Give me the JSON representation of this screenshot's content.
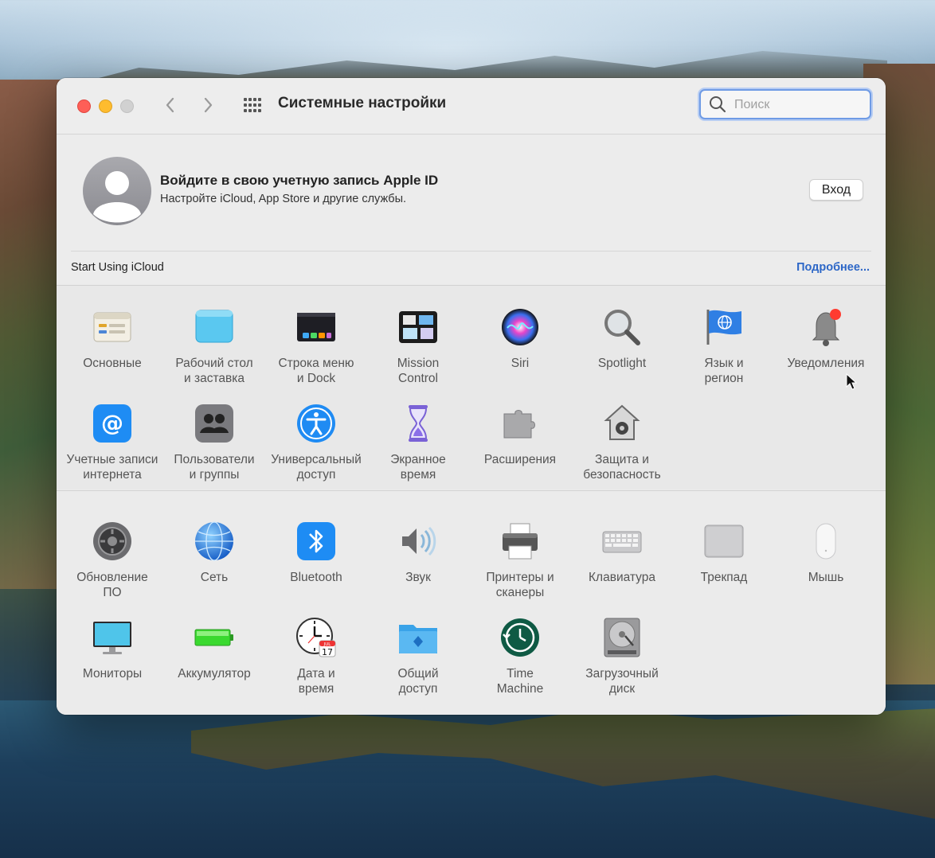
{
  "window": {
    "title": "Системные настройки",
    "search_placeholder": "Поиск"
  },
  "account": {
    "title": "Войдите в свою учетную запись Apple ID",
    "subtitle": "Настройте iCloud, App Store и другие службы.",
    "login_label": "Вход"
  },
  "icloud": {
    "label": "Start Using iCloud",
    "more_label": "Подробнее..."
  },
  "panes_row1": [
    {
      "icon": "general-icon",
      "line1": "Основные",
      "line2": ""
    },
    {
      "icon": "desktop-icon",
      "line1": "Рабочий стол",
      "line2": "и заставка"
    },
    {
      "icon": "menu-bar-dock-icon",
      "line1": "Строка меню",
      "line2": "и Dock"
    },
    {
      "icon": "mission-control-icon",
      "line1": "Mission",
      "line2": "Control"
    },
    {
      "icon": "siri-icon",
      "line1": "Siri",
      "line2": ""
    },
    {
      "icon": "spotlight-icon",
      "line1": "Spotlight",
      "line2": ""
    },
    {
      "icon": "language-region-icon",
      "line1": "Язык и",
      "line2": "регион"
    },
    {
      "icon": "notifications-icon",
      "line1": "Уведомления",
      "line2": ""
    }
  ],
  "panes_row2": [
    {
      "icon": "internet-accounts-icon",
      "line1": "Учетные записи",
      "line2": "интернета"
    },
    {
      "icon": "users-groups-icon",
      "line1": "Пользователи",
      "line2": "и группы"
    },
    {
      "icon": "accessibility-icon",
      "line1": "Универсальный",
      "line2": "доступ"
    },
    {
      "icon": "screen-time-icon",
      "line1": "Экранное",
      "line2": "время"
    },
    {
      "icon": "extensions-icon",
      "line1": "Расширения",
      "line2": ""
    },
    {
      "icon": "security-privacy-icon",
      "line1": "Защита и",
      "line2": "безопасность"
    }
  ],
  "panes_row3": [
    {
      "icon": "software-update-icon",
      "line1": "Обновление",
      "line2": "ПО"
    },
    {
      "icon": "network-icon",
      "line1": "Сеть",
      "line2": ""
    },
    {
      "icon": "bluetooth-icon",
      "line1": "Bluetooth",
      "line2": ""
    },
    {
      "icon": "sound-icon",
      "line1": "Звук",
      "line2": ""
    },
    {
      "icon": "printers-scanners-icon",
      "line1": "Принтеры и",
      "line2": "сканеры"
    },
    {
      "icon": "keyboard-icon",
      "line1": "Клавиатура",
      "line2": ""
    },
    {
      "icon": "trackpad-icon",
      "line1": "Трекпад",
      "line2": ""
    },
    {
      "icon": "mouse-icon",
      "line1": "Мышь",
      "line2": ""
    }
  ],
  "panes_row4": [
    {
      "icon": "displays-icon",
      "line1": "Мониторы",
      "line2": ""
    },
    {
      "icon": "battery-icon",
      "line1": "Аккумулятор",
      "line2": ""
    },
    {
      "icon": "date-time-icon",
      "line1": "Дата и",
      "line2": "время",
      "calendar_month": "JUL",
      "calendar_day": "17"
    },
    {
      "icon": "sharing-icon",
      "line1": "Общий",
      "line2": "доступ"
    },
    {
      "icon": "time-machine-icon",
      "line1": "Time",
      "line2": "Machine"
    },
    {
      "icon": "startup-disk-icon",
      "line1": "Загрузочный",
      "line2": "диск"
    }
  ],
  "colors": {
    "accent_link": "#2d67c7",
    "close": "#fe5f57",
    "minimize": "#febc2e",
    "zoom_disabled": "#d1d1d1"
  }
}
